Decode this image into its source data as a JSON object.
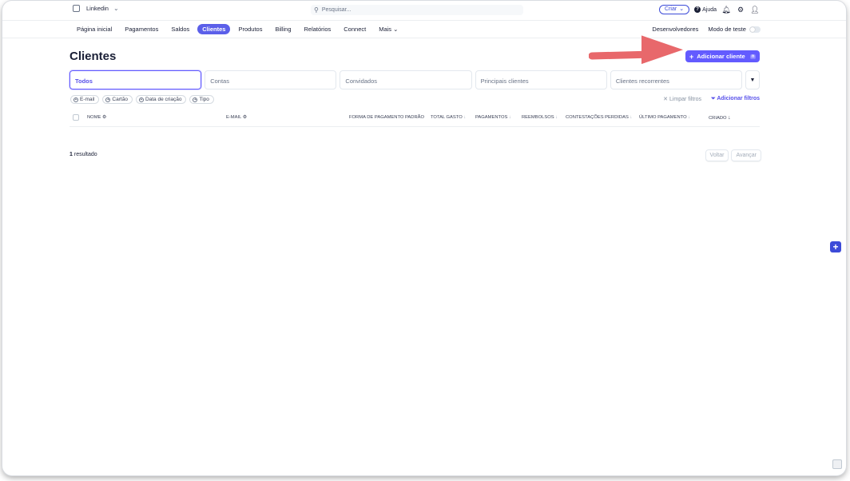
{
  "topbar": {
    "account_name": "Linkedin",
    "search_placeholder": "Pesquisar...",
    "create_label": "Criar",
    "help_label": "Ajuda"
  },
  "nav": {
    "items": [
      "Página inicial",
      "Pagamentos",
      "Saldos",
      "Clientes",
      "Produtos",
      "Billing",
      "Relatórios",
      "Connect",
      "Mais"
    ],
    "active": "Clientes",
    "developers_label": "Desenvolvedores",
    "test_mode_label": "Modo de teste"
  },
  "page": {
    "title": "Clientes",
    "add_button_label": "Adicionar cliente",
    "add_button_shortcut": "n"
  },
  "tabs": [
    "Todos",
    "Contas",
    "Convidados",
    "Principais clientes",
    "Clientes recorrentes"
  ],
  "filters": {
    "chips": [
      "E-mail",
      "Cartão",
      "Data de criação",
      "Tipo"
    ],
    "clear_label": "Limpar filtros",
    "add_label": "Adicionar filtros"
  },
  "table": {
    "columns": [
      "NOME",
      "E-MAIL",
      "FORMA DE PAGAMENTO PADRÃO",
      "TOTAL GASTO",
      "PAGAMENTOS",
      "REEMBOLSOS",
      "CONTESTAÇÕES PERDIDAS",
      "ÚLTIMO PAGAMENTO",
      "CRIADO"
    ]
  },
  "results": {
    "count": "1",
    "label": "resultado"
  },
  "pagination": {
    "prev_label": "Voltar",
    "next_label": "Avançar"
  },
  "colors": {
    "accent": "#635bff",
    "arrow": "#e8686b"
  }
}
